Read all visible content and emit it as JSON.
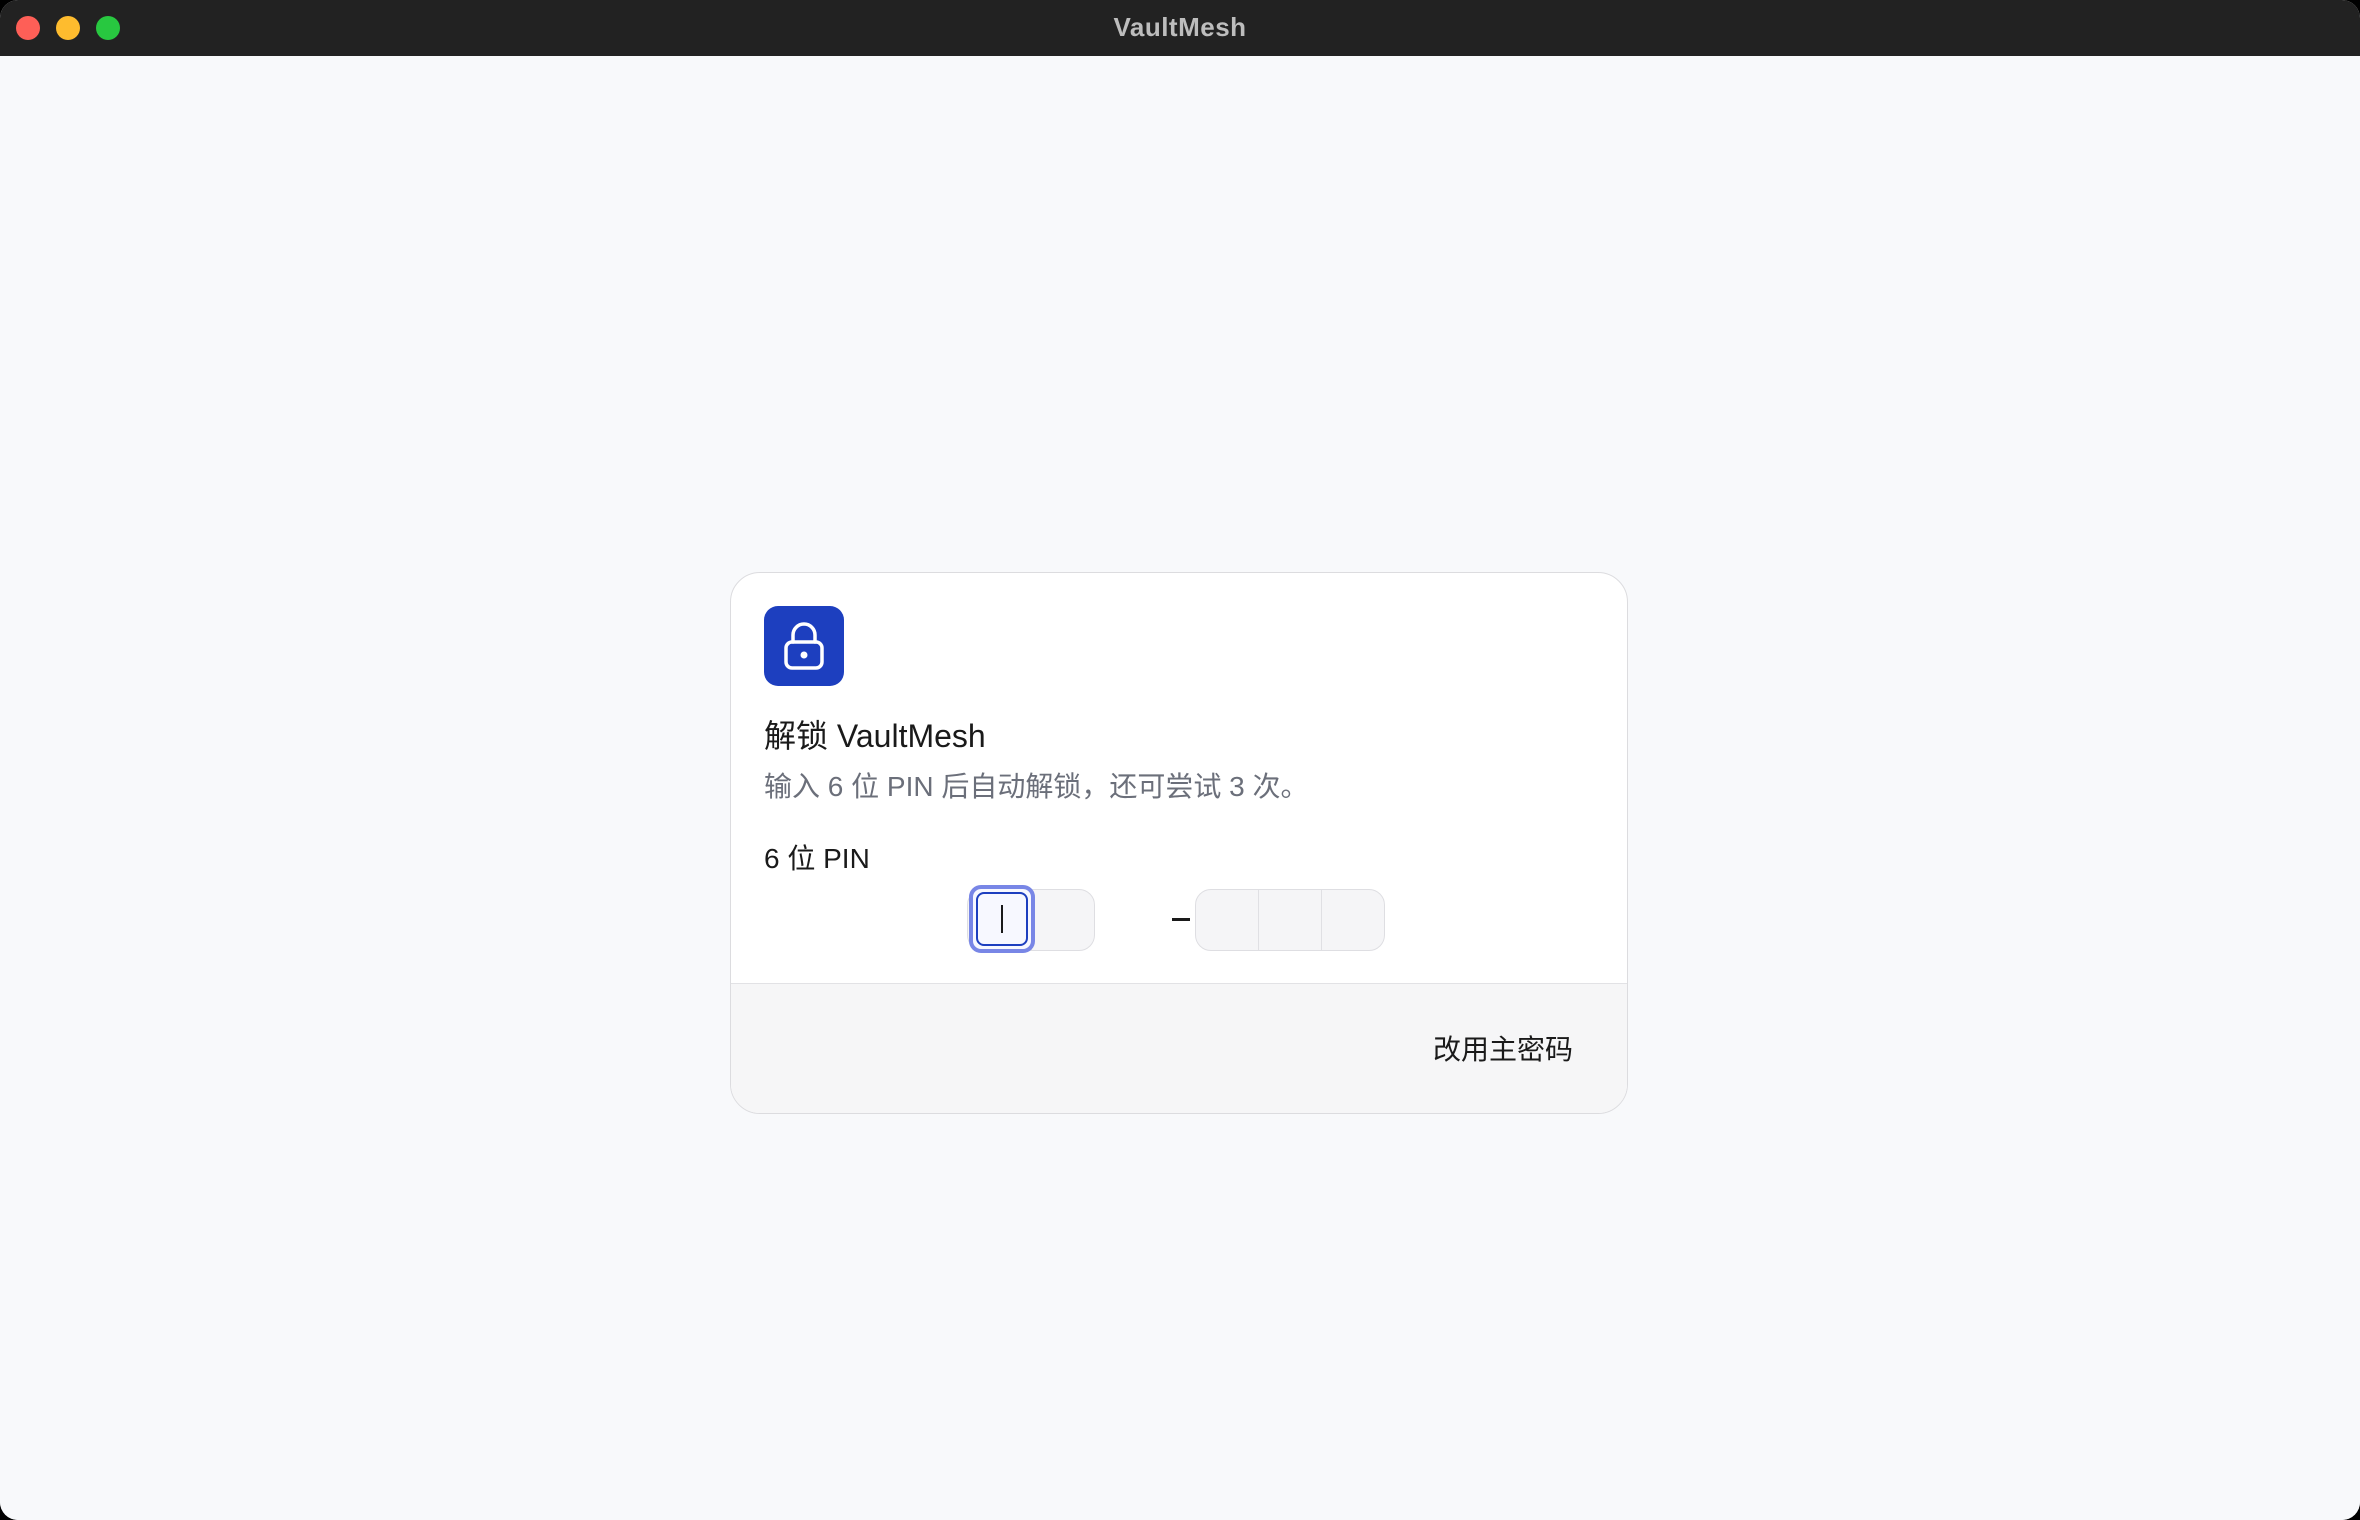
{
  "window": {
    "title": "VaultMesh"
  },
  "unlock": {
    "icon": "lock-icon",
    "title": "解锁 VaultMesh",
    "description": "输入 6 位 PIN 后自动解锁，还可尝试 3 次。",
    "pin_label": "6 位 PIN",
    "pin_length": 6,
    "pin_groups": [
      3,
      3
    ],
    "pin_values": [
      "",
      "",
      "",
      "",
      "",
      ""
    ],
    "separator": "–",
    "alt_button_label": "改用主密码"
  },
  "colors": {
    "accent": "#1d3fbf",
    "focus_ring": "#7886e6",
    "titlebar": "#222222",
    "background": "#f8f9fb"
  }
}
